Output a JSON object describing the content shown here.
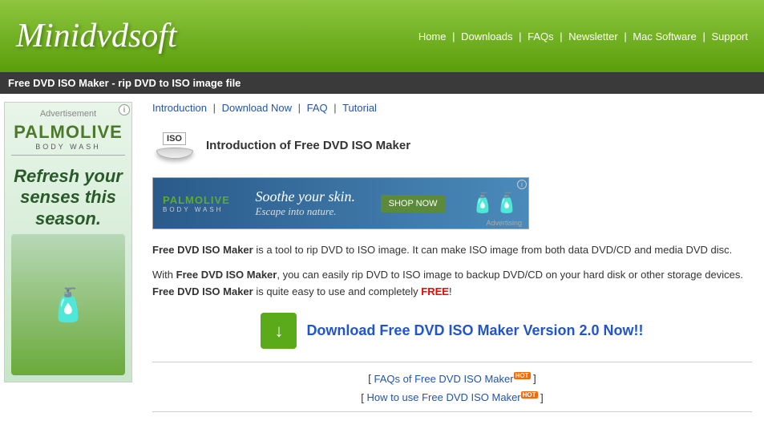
{
  "header": {
    "logo": "Minidvdsoft",
    "nav": {
      "items": [
        "Home",
        "Downloads",
        "FAQs",
        "Newsletter",
        "Mac Software",
        "Support"
      ]
    }
  },
  "page_title": "Free DVD ISO Maker - rip DVD to ISO image file",
  "breadcrumb": {
    "items": [
      "Introduction",
      "Download Now",
      "FAQ",
      "Tutorial"
    ],
    "separators": [
      "|",
      "|",
      "|"
    ]
  },
  "product": {
    "title": "Introduction of Free DVD ISO Maker",
    "description1_prefix": "Free DVD ISO Maker",
    "description1_rest": " is a tool to rip DVD to ISO image. It can make ISO image from both data DVD/CD and media DVD disc.",
    "description2_prefix": "With ",
    "description2_bold": "Free DVD ISO Maker",
    "description2_mid": ", you can easily rip DVD to ISO image to backup DVD/CD on your hard disk or other storage devices. ",
    "description2_bold2": "Free DVD ISO Maker",
    "description2_end": " is quite easy to use and completely ",
    "description2_free": "FREE",
    "description2_exclaim": "!"
  },
  "download": {
    "text": "Download Free DVD ISO Maker Version 2.0 Now!!"
  },
  "links": {
    "faq_text": "FAQs of Free DVD ISO Maker",
    "faq_hot": "HOT",
    "howto_text": "How to use Free DVD ISO Maker",
    "howto_hot": "HOT"
  },
  "ad_sidebar": {
    "brand": "PALMOLIVE",
    "line": "BODY WASH",
    "tagline": "Refresh your senses this season.",
    "info": "i"
  },
  "ad_banner": {
    "brand": "PALMOLIVE",
    "line": "BODY WASH",
    "tagline": "Soothe your skin.",
    "sub": "Escape into nature.",
    "btn": "SHOP NOW",
    "info": "i"
  }
}
